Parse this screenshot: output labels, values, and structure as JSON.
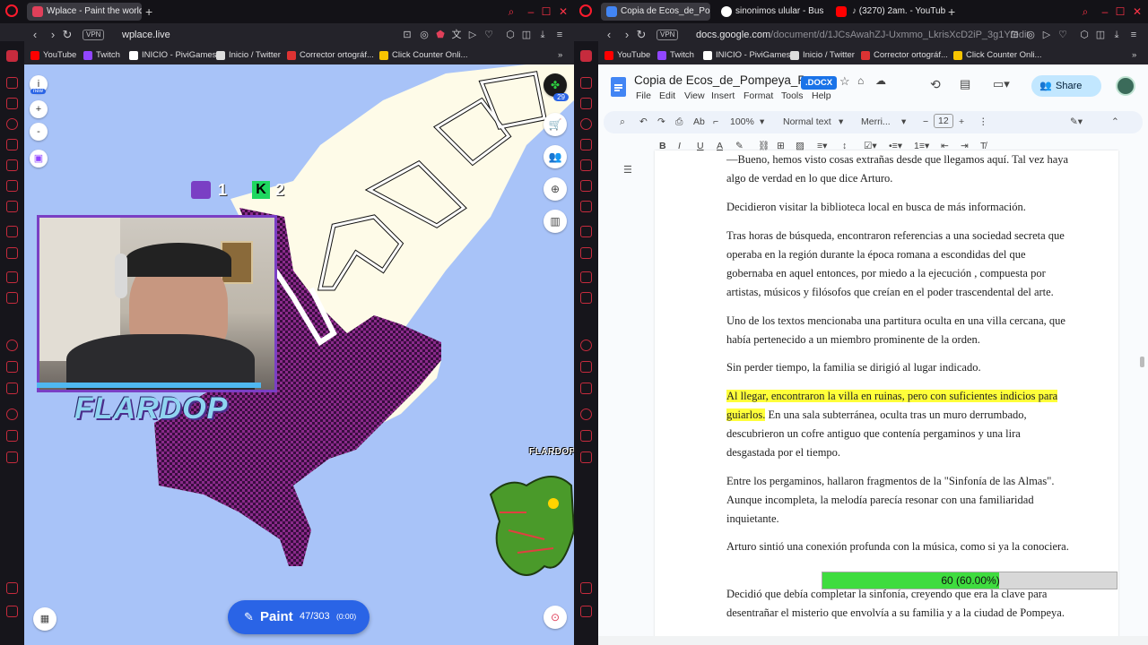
{
  "left_window": {
    "tab_title": "Wplace - Paint the world",
    "url": "wplace.live",
    "vpn_label": "VPN",
    "bookmarks": [
      "YouTube",
      "Twitch",
      "INICIO - PiviGames",
      "Inicio / Twitter",
      "Corrector ortográf...",
      "Click Counter Onli..."
    ],
    "map_controls": {
      "info_label": "i",
      "new_badge": "new",
      "zoom_in": "+",
      "zoom_out": "-"
    },
    "notification_count": "29",
    "badge_twitch_count": "1",
    "badge_kick_count": "2",
    "streamer_name_big": "FLARDOP",
    "streamer_name_small": "FLARDOP",
    "paint_button": {
      "label": "Paint",
      "count": "47/303",
      "timer": "(0:00)"
    }
  },
  "right_window": {
    "tabs": [
      {
        "title": "Copia de Ecos_de_Pompe",
        "color": "#4285f4"
      },
      {
        "title": "sinonimos ulular - Busca",
        "color": "#ffffff"
      },
      {
        "title": "(3270) 2am. - YouTub",
        "color": "#ff0000"
      }
    ],
    "url_prefix": "docs.google.com",
    "url_path": "/document/d/1JCsAwahZJ-Uxmmo_LkrisXcD2iP_3g1Y/edit",
    "vpn_label": "VPN",
    "bookmarks": [
      "YouTube",
      "Twitch",
      "INICIO - PiviGames",
      "Inicio / Twitter",
      "Corrector ortográf...",
      "Click Counter Onli..."
    ],
    "doc": {
      "title": "Copia de Ecos_de_Pompeya_P...",
      "badge": ".DOCX",
      "menus": [
        "File",
        "Edit",
        "View",
        "Insert",
        "Format",
        "Tools",
        "Help"
      ],
      "share_label": "Share",
      "zoom": "100%",
      "style": "Normal text",
      "font": "Merri...",
      "font_size": "12",
      "paragraphs": [
        {
          "text": "—Bueno, hemos visto cosas extrañas desde que llegamos aquí. Tal vez haya algo de verdad en lo que dice Arturo."
        },
        {
          "text": "Decidieron visitar la biblioteca local en busca de más información."
        },
        {
          "text": "Tras horas de búsqueda, encontraron referencias a una sociedad secreta que operaba en la región durante la época romana a escondidas del que gobernaba en aquel entonces, por miedo a la ejecución , compuesta por artistas, músicos y filósofos que creían en el poder trascendental del arte."
        },
        {
          "text": "Uno de los textos mencionaba una partitura oculta en una villa cercana, que había pertenecido a un miembro prominente de la orden."
        },
        {
          "text": "Sin perder tiempo, la familia se dirigió al lugar indicado."
        },
        {
          "highlight": "Al llegar, encontraron la villa en ruinas, pero con suficientes indicios para guiarlos.",
          "text": " En una sala subterránea, oculta tras un muro derrumbado, descubrieron un cofre antiguo que contenía pergaminos y una lira desgastada por el tiempo."
        },
        {
          "text": "Entre los pergaminos, hallaron fragmentos de la \"Sinfonía de las Almas\". Aunque incompleta, la melodía parecía resonar con una familiaridad inquietante."
        },
        {
          "text": "Arturo sintió una conexión profunda con la música, como si ya la conociera."
        },
        {
          "text": "Decidió que debía completar la sinfonía, creyendo que era la clave para desentrañar el misterio que envolvía a su familia y a la ciudad de Pompeya."
        }
      ]
    },
    "progress": {
      "label": "60 (60.00%)",
      "fraction": 0.6
    }
  }
}
